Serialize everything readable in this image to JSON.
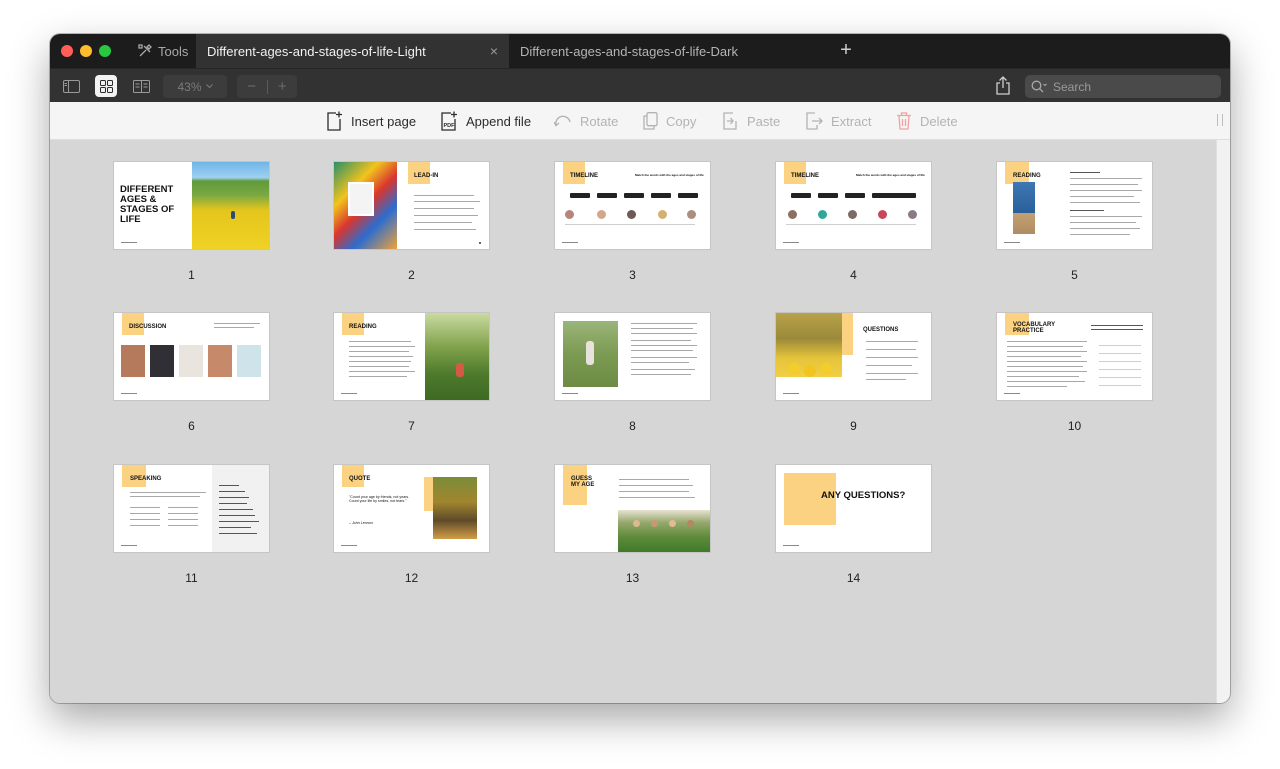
{
  "titlebar": {
    "tools_label": "Tools",
    "tabs": [
      {
        "label": "Different-ages-and-stages-of-life-Light",
        "active": true
      },
      {
        "label": "Different-ages-and-stages-of-life-Dark",
        "active": false
      }
    ],
    "close_glyph": "×",
    "new_tab_glyph": "+"
  },
  "viewbar": {
    "zoom": "43%",
    "zoom_out": "−",
    "zoom_in": "+",
    "search_placeholder": "Search",
    "icons": [
      "sidebar-icon",
      "grid-view-icon",
      "two-page-icon",
      "share-icon",
      "search-icon"
    ]
  },
  "actions": {
    "insert_page": "Insert page",
    "append_file": "Append file",
    "rotate": "Rotate",
    "copy": "Copy",
    "paste": "Paste",
    "extract": "Extract",
    "delete": "Delete"
  },
  "pages": [
    {
      "number": "1",
      "title": "DIFFERENT AGES & STAGES OF LIFE"
    },
    {
      "number": "2",
      "title": "LEAD-IN"
    },
    {
      "number": "3",
      "title": "TIMELINE",
      "subtitle": "Match the words with the ages and stages of life"
    },
    {
      "number": "4",
      "title": "TIMELINE",
      "subtitle": "Match the words with the ages and stages of life"
    },
    {
      "number": "5",
      "title": "READING"
    },
    {
      "number": "6",
      "title": "DISCUSSION"
    },
    {
      "number": "7",
      "title": "READING"
    },
    {
      "number": "8",
      "title": ""
    },
    {
      "number": "9",
      "title": "QUESTIONS"
    },
    {
      "number": "10",
      "title": "VOCABULARY PRACTICE"
    },
    {
      "number": "11",
      "title": "SPEAKING"
    },
    {
      "number": "12",
      "title": "QUOTE",
      "quote": "\"Count your age by friends, not years. Count your life by smiles, not tears.\"",
      "author": "– John Lennon"
    },
    {
      "number": "13",
      "title": "GUESS MY AGE"
    },
    {
      "number": "14",
      "title": "ANY QUESTIONS?"
    }
  ],
  "colors": {
    "accent": "#fbd281",
    "titlebar": "#1c1c1c",
    "toolbar": "#323232",
    "canvas": "#d6d6d6"
  }
}
